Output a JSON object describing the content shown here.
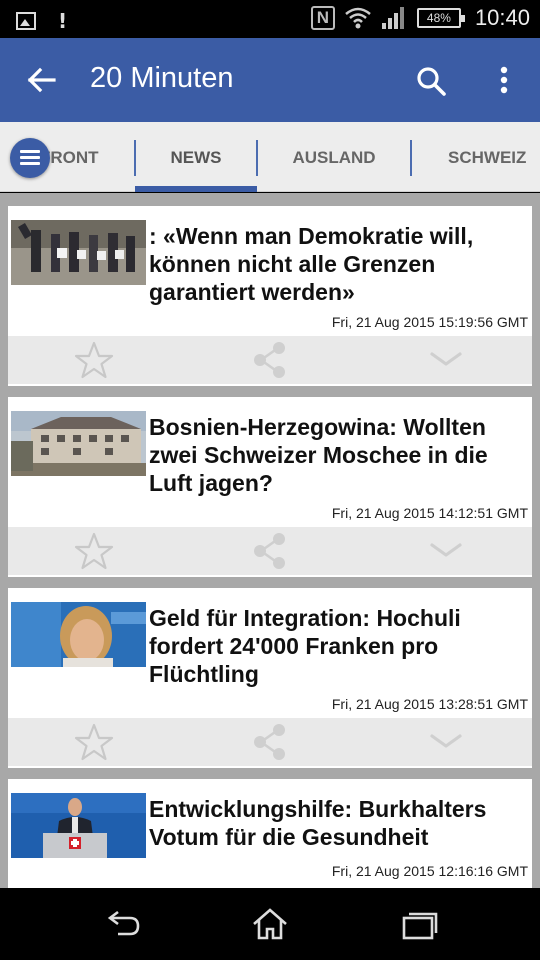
{
  "status_bar": {
    "battery": "48%",
    "time": "10:40"
  },
  "app_bar": {
    "title": "20 Minuten"
  },
  "tabs": [
    {
      "label": "FRONT",
      "active": false
    },
    {
      "label": "NEWS",
      "active": true
    },
    {
      "label": "AUSLAND",
      "active": false
    },
    {
      "label": "SCHWEIZ",
      "active": false
    }
  ],
  "articles": [
    {
      "headline": ": «Wenn man Demokratie will, können nicht alle Grenzen garantiert werden»",
      "date": "Fri, 21 Aug 2015 15:19:56 GMT"
    },
    {
      "headline": "Bosnien-Herzegowina: Wollten zwei Schweizer Moschee in die Luft jagen?",
      "date": "Fri, 21 Aug 2015 14:12:51 GMT"
    },
    {
      "headline": "Geld für Integration: Hochuli fordert 24'000 Franken pro Flüchtling",
      "date": "Fri, 21 Aug 2015 13:28:51 GMT"
    },
    {
      "headline": "Entwicklungshilfe: Burkhalters Votum für die Gesundheit",
      "date": "Fri, 21 Aug 2015 12:16:16 GMT"
    }
  ],
  "colors": {
    "primary": "#3b5ca5",
    "tab_background": "#ededed",
    "feed_background": "#a8a8a8",
    "action_row": "#e9e9e9"
  }
}
